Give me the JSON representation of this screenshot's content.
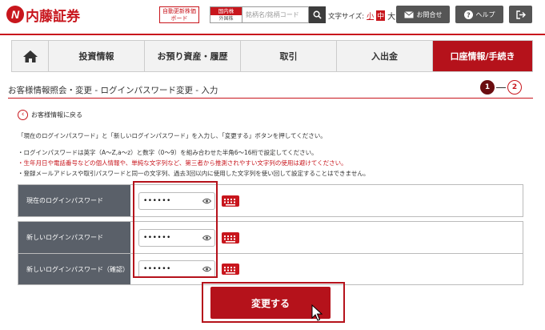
{
  "header": {
    "logo_text": "内藤証券",
    "realtime_button": "自動更新株価ボード",
    "market_top": "国内株",
    "market_bottom": "外国株",
    "search_placeholder": "銘柄名/銘柄コード",
    "fontsize_label": "文字サイズ:",
    "fontsize_small": "小",
    "fontsize_mid": "中",
    "fontsize_large": "大",
    "contact_label": "お問合せ",
    "help_label": "ヘルプ"
  },
  "nav": {
    "items": [
      {
        "label": "投資情報"
      },
      {
        "label": "お預り資産・履歴"
      },
      {
        "label": "取引"
      },
      {
        "label": "入出金"
      },
      {
        "label": "口座情報/手続き"
      }
    ],
    "active_index": 4
  },
  "page": {
    "title": "お客様情報照会・変更 - ログインパスワード変更 - 入力",
    "steps": [
      "1",
      "2"
    ],
    "current_step": 1,
    "back_link": "お客様情報に戻る",
    "notes": [
      {
        "text": "「現在のログインパスワード」と「新しいログインパスワード」を入力し、「変更する」ボタンを押してください。",
        "red": false
      },
      {
        "text": "・ログインパスワードは英字（A～Z,a～z）と数字（0～9）を組み合わせた半角6～16桁で設定してください。",
        "red": false
      },
      {
        "text": "・生年月日や電話番号などの個人情報や、単純な文字列など、第三者から推測されやすい文字列の使用は避けてください。",
        "red": true
      },
      {
        "text": "・登録メールアドレスや取引パスワードと同一の文字列、過去3回以内に使用した文字列を使い回して設定することはできません。",
        "red": false
      }
    ]
  },
  "form": {
    "current_password_label": "現在のログインパスワード",
    "current_password_value": "••••••",
    "new_password_label": "新しいログインパスワード",
    "new_password_value": "••••••",
    "confirm_password_label": "新しいログインパスワード（確認）",
    "confirm_password_value": "••••••",
    "submit_label": "変更する"
  },
  "colors": {
    "brand_red": "#c8161d",
    "active_nav": "#b5121b",
    "label_bg": "#5a6069"
  }
}
